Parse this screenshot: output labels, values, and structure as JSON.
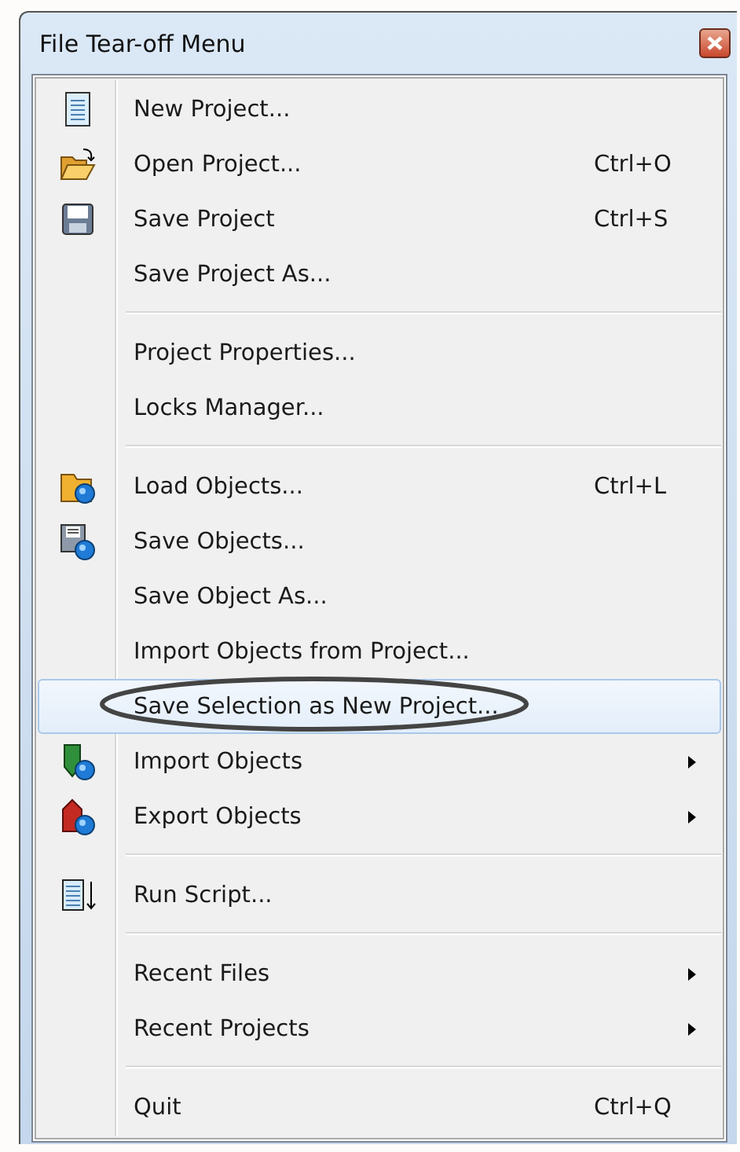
{
  "window": {
    "title": "File Tear-off Menu"
  },
  "sections": [
    [
      {
        "label": "New Project...",
        "selected": false
      },
      {
        "label": "Open Project...",
        "shortcut": "Ctrl+O",
        "selected": false
      },
      {
        "label": "Save Project",
        "shortcut": "Ctrl+S",
        "selected": false
      },
      {
        "label": "Save Project As...",
        "selected": false
      }
    ],
    [
      {
        "label": "Project Properties...",
        "selected": false
      },
      {
        "label": "Locks Manager...",
        "selected": false
      }
    ],
    [
      {
        "label": "Load Objects...",
        "shortcut": "Ctrl+L",
        "selected": false
      },
      {
        "label": "Save Objects...",
        "selected": false
      },
      {
        "label": "Save Object As...",
        "selected": false
      },
      {
        "label": "Import Objects from Project...",
        "selected": false
      },
      {
        "label": "Save Selection as New Project...",
        "selected": true,
        "circled": true
      },
      {
        "label": "Import Objects",
        "submenu": true,
        "selected": false
      },
      {
        "label": "Export Objects",
        "submenu": true,
        "selected": false
      }
    ],
    [
      {
        "label": "Run Script...",
        "selected": false
      }
    ],
    [
      {
        "label": "Recent Files",
        "submenu": true,
        "selected": false
      },
      {
        "label": "Recent Projects",
        "submenu": true,
        "selected": false
      }
    ],
    [
      {
        "label": "Quit",
        "shortcut": "Ctrl+Q",
        "selected": false
      }
    ]
  ]
}
